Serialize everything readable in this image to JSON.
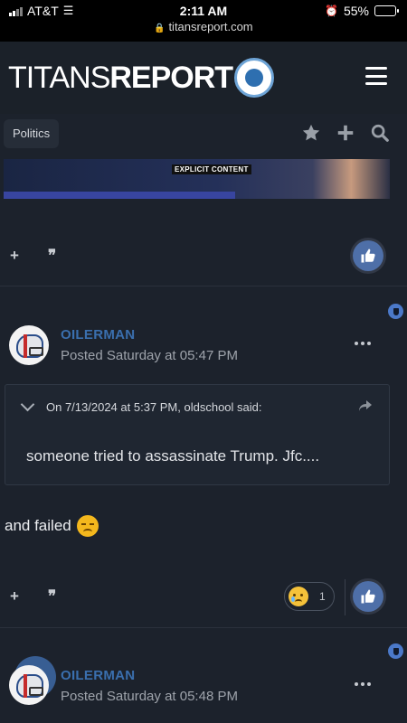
{
  "status_bar": {
    "carrier": "AT&T",
    "time": "2:11 AM",
    "battery": "55%",
    "battery_level": 0.55,
    "url": "titansreport.com"
  },
  "header": {
    "logo_thin": "TITANS",
    "logo_bold": "REPORT",
    "logo_badge_icon": "titans-report-badge-icon",
    "menu_icon": "hamburger-menu-icon"
  },
  "breadcrumb": {
    "label": "Politics",
    "tools": [
      "star-icon",
      "plus-icon",
      "search-icon"
    ]
  },
  "embed": {
    "explicit_label": "EXPLICIT CONTENT"
  },
  "post_actions_icons": {
    "add": "+",
    "quote": "❞"
  },
  "posts": [
    {
      "author": "OILERMAN",
      "posted": "Posted Saturday at 05:47 PM",
      "quote": {
        "attribution": "On 7/13/2024 at 5:37 PM, oldschool said:",
        "text": "someone tried to assassinate Trump. Jfc...."
      },
      "body": "and failed",
      "reaction": {
        "emoji": "sad-tear-emoji",
        "count": "1"
      }
    },
    {
      "author": "OILERMAN",
      "posted": "Posted Saturday at 05:48 PM"
    }
  ],
  "colors": {
    "background": "#1c222c",
    "author_link": "#3a6fae",
    "like_button": "#4e6fa8",
    "badge": "#4b79c9"
  }
}
